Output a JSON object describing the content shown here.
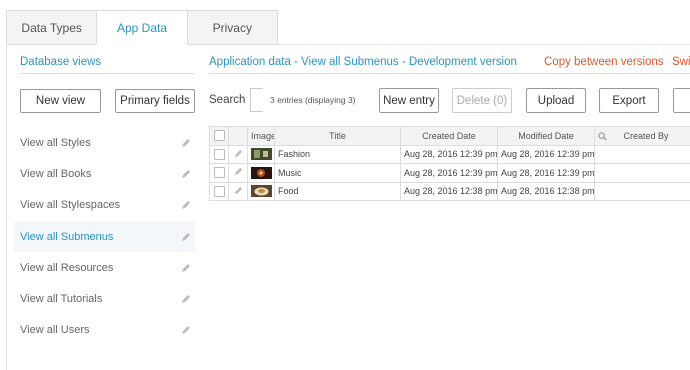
{
  "tabs": [
    {
      "label": "Data Types",
      "active": false
    },
    {
      "label": "App Data",
      "active": true
    },
    {
      "label": "Privacy",
      "active": false
    }
  ],
  "sidebar": {
    "heading": "Database views",
    "new_view_label": "New view",
    "primary_fields_label": "Primary fields",
    "items": [
      {
        "label": "View all Styles",
        "active": false
      },
      {
        "label": "View all Books",
        "active": false
      },
      {
        "label": "View all Stylespaces",
        "active": false
      },
      {
        "label": "View all Submenus",
        "active": true
      },
      {
        "label": "View all Resources",
        "active": false
      },
      {
        "label": "View all Tutorials",
        "active": false
      },
      {
        "label": "View all Users",
        "active": false
      }
    ]
  },
  "main": {
    "title": "Application data - View all Submenus - Development version",
    "copy_link": "Copy between versions",
    "switch_link": "Swit",
    "search_label": "Search",
    "entries_text": "3 entries (displaying 3)",
    "toolbar": {
      "new_entry": "New entry",
      "delete": "Delete (0)",
      "upload": "Upload",
      "export": "Export"
    }
  },
  "table": {
    "headers": {
      "image": "Image",
      "title": "Title",
      "created": "Created Date",
      "modified": "Modified Date",
      "created_by": "Created By"
    },
    "rows": [
      {
        "title": "Fashion",
        "created": "Aug 28, 2016 12:39 pm",
        "modified": "Aug 28, 2016 12:39 pm",
        "thumb_color": "#3f4a2c"
      },
      {
        "title": "Music",
        "created": "Aug 28, 2016 12:39 pm",
        "modified": "Aug 28, 2016 12:39 pm",
        "thumb_color": "#6b2a1a"
      },
      {
        "title": "Food",
        "created": "Aug 28, 2016 12:38 pm",
        "modified": "Aug 28, 2016 12:38 pm",
        "thumb_color": "#c9b48a"
      }
    ]
  },
  "colors": {
    "accent": "#2a95c5",
    "link_orange": "#e3572a"
  }
}
